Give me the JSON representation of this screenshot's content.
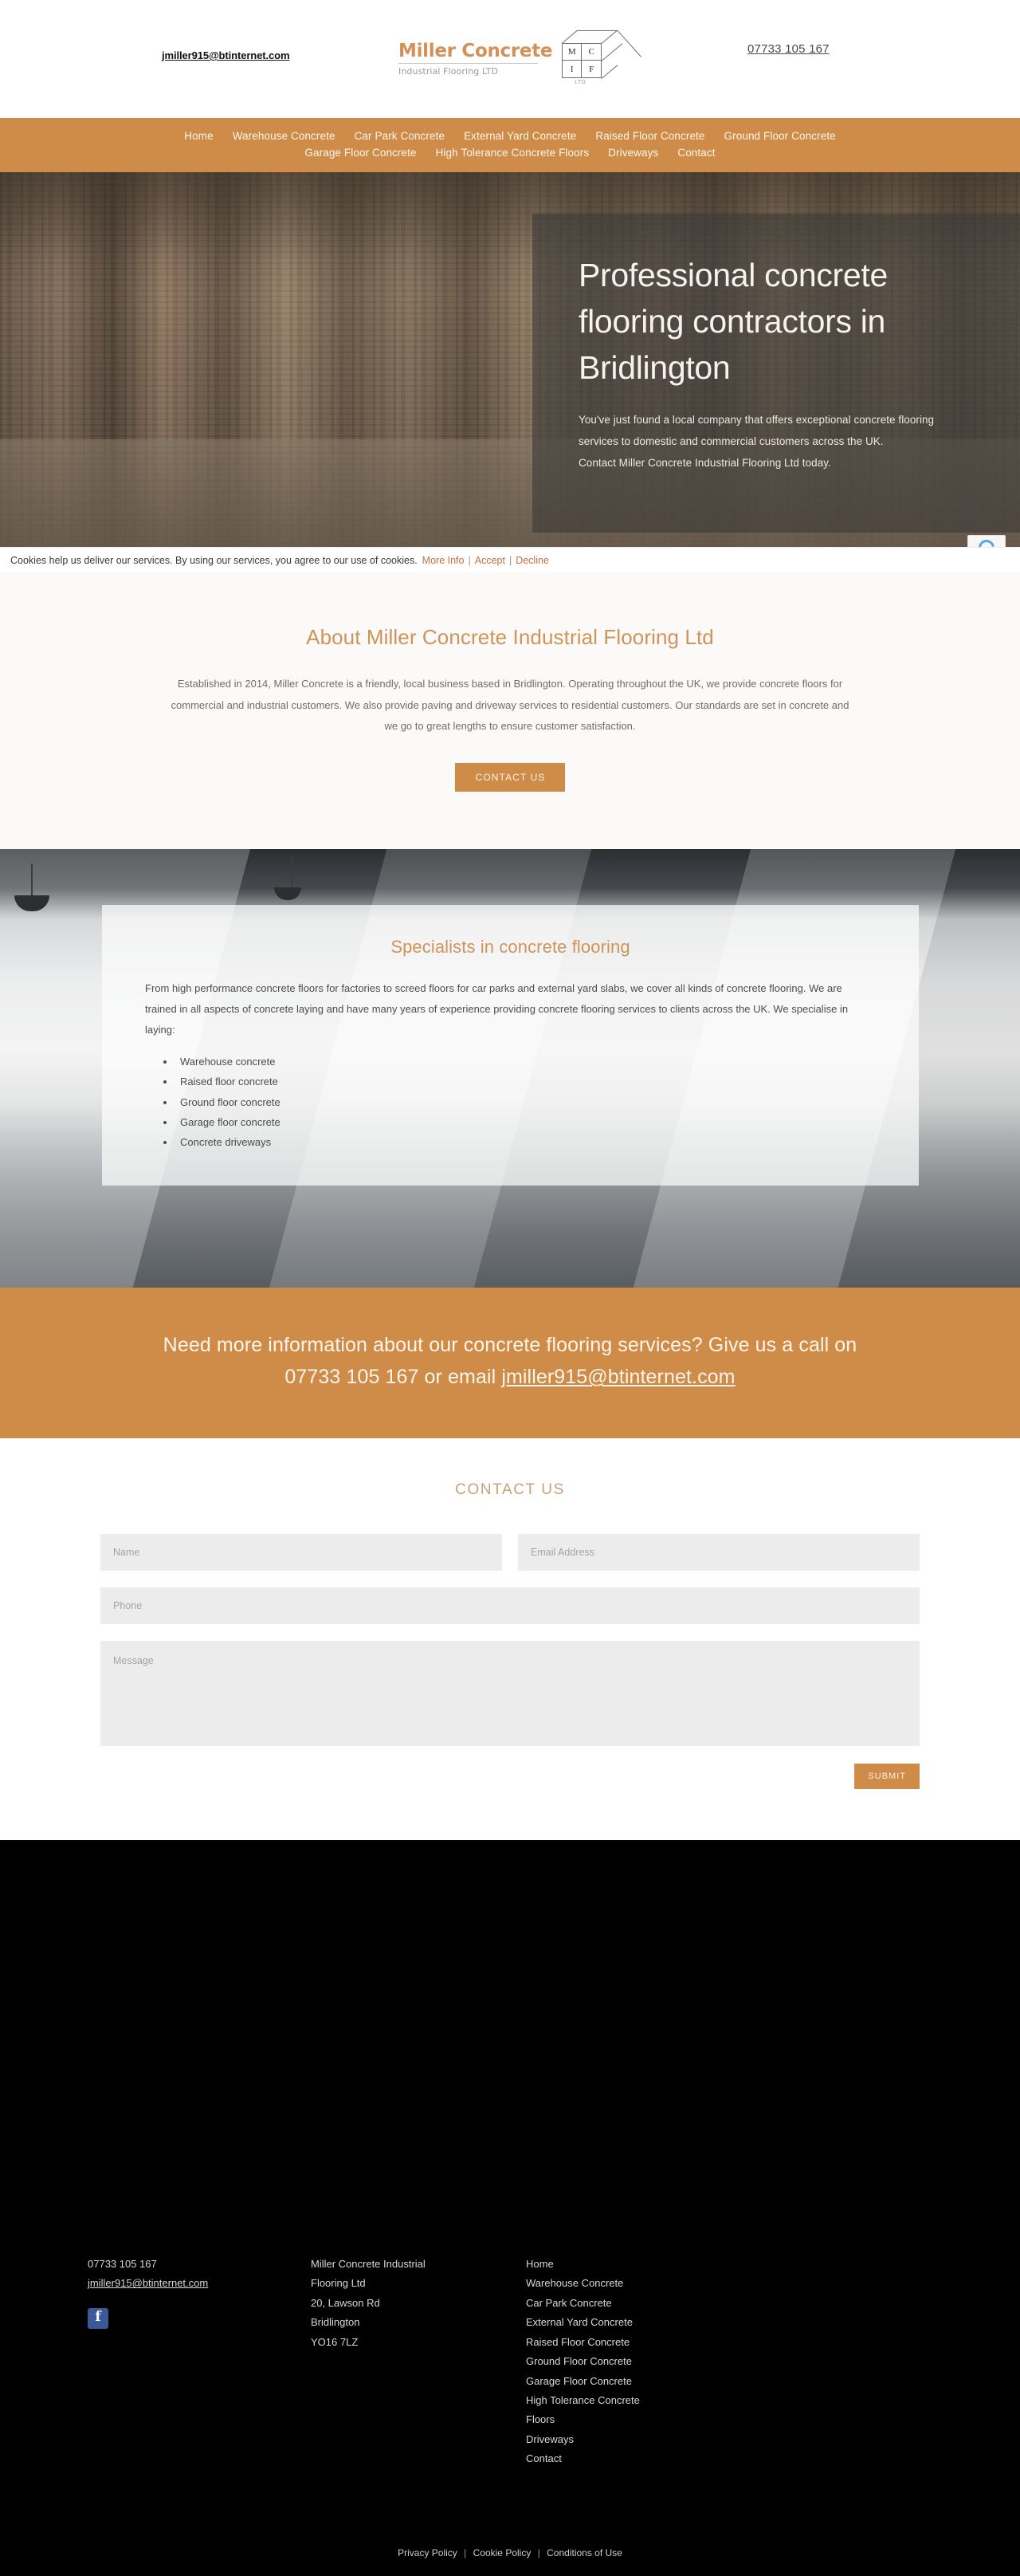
{
  "header": {
    "email": "jmiller915@btinternet.com",
    "phone": "07733 105 167",
    "logo": {
      "title": "Miller Concrete",
      "subtitle": "Industrial Flooring LTD",
      "cube_letters": [
        "M",
        "C",
        "I",
        "F"
      ],
      "ltd_mark": "LTD"
    }
  },
  "nav": {
    "row1": [
      {
        "label": "Home"
      },
      {
        "label": "Warehouse Concrete"
      },
      {
        "label": "Car Park Concrete"
      },
      {
        "label": "External Yard Concrete"
      },
      {
        "label": "Raised Floor Concrete"
      },
      {
        "label": "Ground Floor Concrete"
      }
    ],
    "row2": [
      {
        "label": "Garage Floor Concrete"
      },
      {
        "label": "High Tolerance Concrete Floors"
      },
      {
        "label": "Driveways"
      },
      {
        "label": "Contact"
      }
    ]
  },
  "hero": {
    "title": "Professional concrete flooring contractors in Bridlington",
    "subtitle_line1": "You've just found a local company that offers exceptional concrete flooring",
    "subtitle_line2": "services to domestic and commercial customers across the UK.",
    "subtitle_line3": "Contact Miller Concrete Industrial Flooring Ltd today."
  },
  "cookie_bar": {
    "message": "Cookies help us deliver our services. By using our services, you agree to our use of cookies.",
    "more_info": "More Info",
    "accept": "Accept",
    "decline": "Decline",
    "separator": "|"
  },
  "about": {
    "title": "About Miller Concrete Industrial Flooring Ltd",
    "body": "Established in 2014, Miller Concrete is a friendly, local business based in Bridlington. Operating throughout the UK, we provide concrete floors for commercial and industrial customers. We also provide paving and driveway services to residential customers. Our standards are set in concrete and we go to great lengths to ensure customer satisfaction.",
    "button_label": "CONTACT US"
  },
  "specialists": {
    "title": "Specialists in concrete flooring",
    "body": "From high performance concrete floors for factories to screed floors for car parks and external yard slabs, we cover all kinds of concrete flooring. We are trained in all aspects of concrete laying and have many years of experience providing concrete flooring services to clients across the UK. We specialise in laying:",
    "items": [
      "Warehouse concrete",
      "Raised floor concrete",
      "Ground floor concrete",
      "Garage floor concrete",
      "Concrete driveways"
    ]
  },
  "cta": {
    "line1": "Need more information about our concrete flooring services? Give us a call on",
    "line2_prefix": "07733 105 167 or email ",
    "email": "jmiller915@btinternet.com"
  },
  "contact_form": {
    "title": "CONTACT US",
    "name_placeholder": "Name",
    "email_placeholder": "Email Address",
    "phone_placeholder": "Phone",
    "message_placeholder": "Message",
    "submit_label": "SUBMIT"
  },
  "footer": {
    "phone": "07733 105 167",
    "email": "jmiller915@btinternet.com",
    "social": {
      "facebook_glyph": "f"
    },
    "address": [
      "Miller Concrete Industrial",
      "Flooring Ltd",
      "20, Lawson Rd",
      "Bridlington",
      "YO16 7LZ"
    ],
    "links": [
      "Home",
      "Warehouse Concrete",
      "Car Park Concrete",
      "External Yard Concrete",
      "Raised Floor Concrete",
      "Ground Floor Concrete",
      "Garage Floor Concrete",
      "High Tolerance Concrete",
      "Floors",
      "Driveways",
      "Contact"
    ],
    "legal": {
      "privacy": "Privacy Policy",
      "cookie": "Cookie Policy",
      "conditions": "Conditions of Use",
      "separator": "|"
    }
  },
  "colors": {
    "brand_orange": "#cf8c48",
    "brand_light": "#cf9459",
    "footer_bg": "#000000",
    "facebook_blue": "#3b5998"
  }
}
